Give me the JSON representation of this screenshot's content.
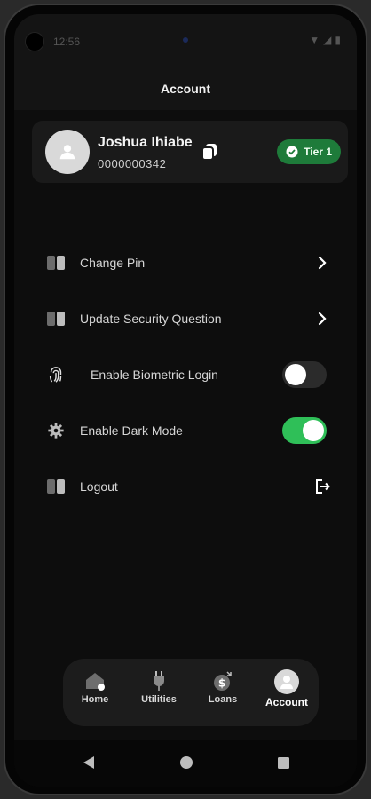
{
  "status_bar": {
    "time": "12:56",
    "icons": "▼◢▮"
  },
  "header": {
    "title": "Account"
  },
  "profile": {
    "name": "Joshua Ihiabe",
    "account_number": "0000000342",
    "tier_label": "Tier 1"
  },
  "menu": [
    {
      "label": "Change Pin",
      "icon": "shield-icon",
      "action": "chevron"
    },
    {
      "label": "Update Security Question",
      "icon": "shield-icon",
      "action": "chevron"
    },
    {
      "label": "Enable Biometric Login",
      "icon": "fingerprint-icon",
      "action": "toggle",
      "enabled": false
    },
    {
      "label": "Enable Dark Mode",
      "icon": "gear-icon",
      "action": "toggle",
      "enabled": true
    },
    {
      "label": "Logout",
      "icon": "shield-icon",
      "action": "logout"
    }
  ],
  "bottom_nav": [
    {
      "label": "Home",
      "icon": "home-icon",
      "active": false
    },
    {
      "label": "Utilities",
      "icon": "plug-icon",
      "active": false
    },
    {
      "label": "Loans",
      "icon": "money-bag-icon",
      "active": false
    },
    {
      "label": "Account",
      "icon": "user-avatar-icon",
      "active": true
    }
  ],
  "colors": {
    "background": "#0d0d0d",
    "card": "#1a1a1a",
    "tier_badge": "#1e7b3a",
    "toggle_on": "#2fbf58",
    "toggle_off": "#2b2b2b"
  }
}
